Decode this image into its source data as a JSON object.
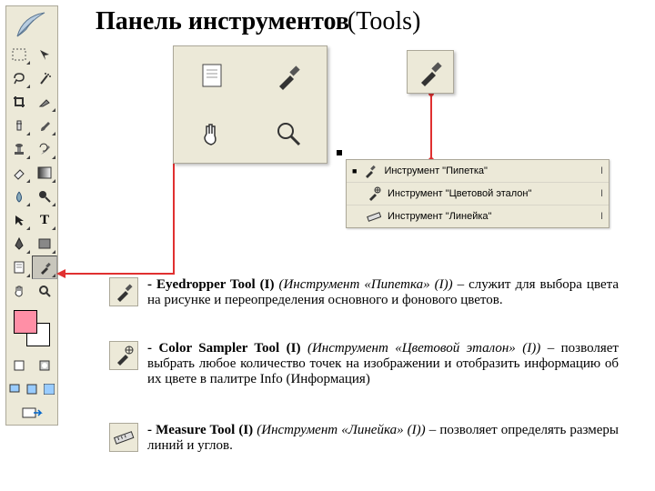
{
  "title": {
    "main": "Панель инструментов",
    "suffix": "(Tools)"
  },
  "toolbar": {
    "rows": [
      [
        "marquee",
        "move"
      ],
      [
        "lasso",
        "wand"
      ],
      [
        "crop",
        "slice"
      ],
      [
        "heal",
        "brush"
      ],
      [
        "stamp",
        "history"
      ],
      [
        "eraser",
        "gradient"
      ],
      [
        "blur",
        "dodge"
      ],
      [
        "path",
        "type"
      ],
      [
        "pen",
        "shape"
      ],
      [
        "notes",
        "eyedropper"
      ],
      [
        "hand",
        "zoom"
      ]
    ]
  },
  "popup": {
    "cells": [
      "notes-icon",
      "eyedropper-icon",
      "hand-icon",
      "zoom-icon"
    ]
  },
  "popup2": {
    "icon": "eyedropper-icon"
  },
  "flyout": {
    "items": [
      {
        "icon": "eyedropper",
        "label": "Инструмент \"Пипетка\"",
        "key": "I"
      },
      {
        "icon": "colorsampler",
        "label": "Инструмент \"Цветовой эталон\"",
        "key": "I"
      },
      {
        "icon": "ruler",
        "label": "Инструмент \"Линейка\"",
        "key": "I"
      }
    ]
  },
  "descriptions": [
    {
      "icon": "eyedropper",
      "strong": " - Eyedropper Tool (I) ",
      "ital": "(Инструмент «Пипетка» (I)) ",
      "rest": "– служит для выбора цвета на рисунке и переопределения основного и фонового цветов."
    },
    {
      "icon": "colorsampler",
      "strong": " - Color Sampler Tool (I) ",
      "ital": "(Инструмент «Цветовой эталон» (I)) ",
      "rest": "– позволяет выбрать любое количество точек на изображении и отобразить информацию об их цвете в палитре Info (Информация)"
    },
    {
      "icon": "ruler",
      "strong": " - Measure Tool (I) ",
      "ital": "(Инструмент «Линейка» (I)) ",
      "rest": "– позволяет определять размеры линий и углов."
    }
  ]
}
